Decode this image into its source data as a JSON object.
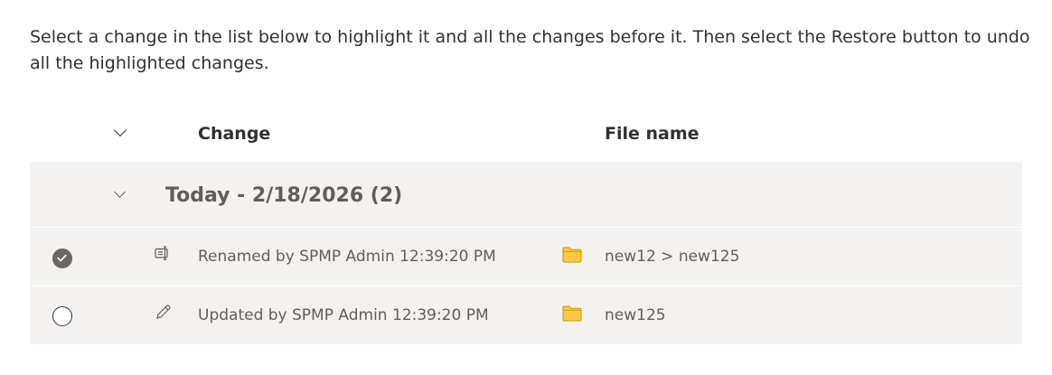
{
  "instructions": "Select a change in the list below to highlight it and all the changes before it. Then select the Restore button to undo all the highlighted changes.",
  "list": {
    "columns": {
      "change": "Change",
      "file_name": "File name"
    },
    "group": {
      "title": "Today - 2/18/2026 (2)",
      "expanded": true
    },
    "rows": [
      {
        "selected": true,
        "change_icon": "rename-icon",
        "change": "Renamed by SPMP Admin 12:39:20 PM",
        "file_icon": "folder-icon",
        "file_name": "new12 > new125"
      },
      {
        "selected": false,
        "change_icon": "pencil-icon",
        "change": "Updated by SPMP Admin 12:39:20 PM",
        "file_icon": "folder-icon",
        "file_name": "new125"
      }
    ]
  },
  "colors": {
    "row_background": "#f3f2f1",
    "folder_fill": "#ffc947",
    "folder_stroke": "#c19c00",
    "checked_fill": "#6a6866"
  }
}
